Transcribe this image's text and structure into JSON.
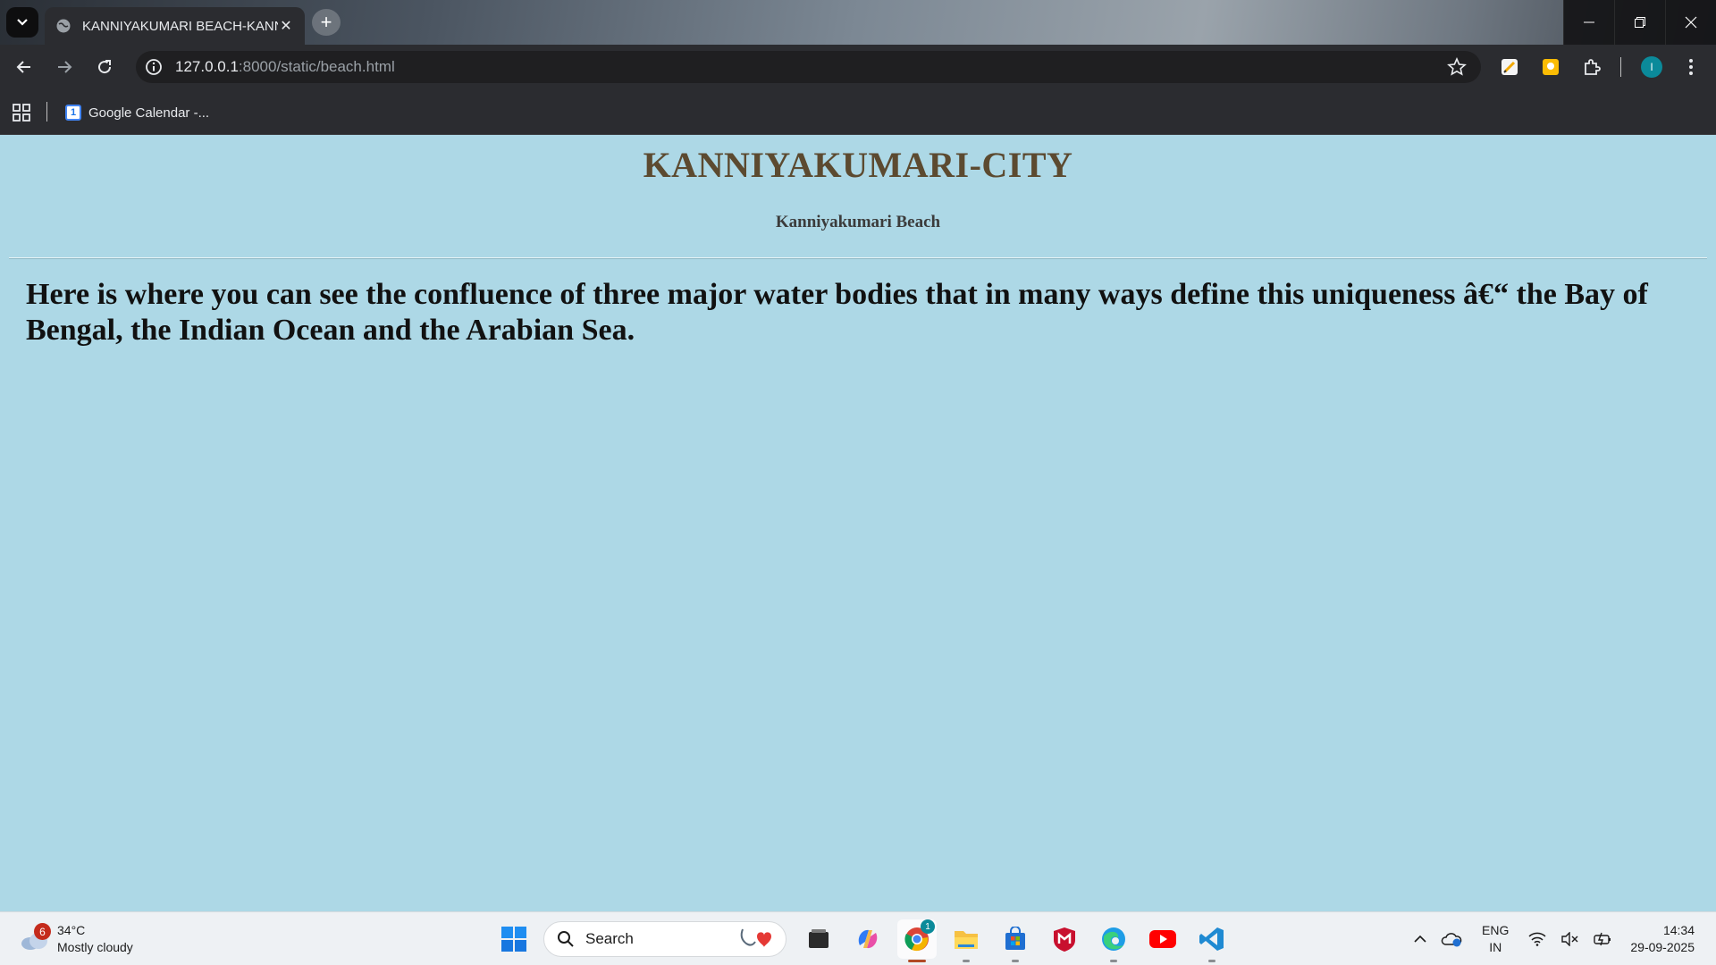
{
  "browser": {
    "tab_title": "KANNIYAKUMARI BEACH-KANNIYAKUMARI",
    "url_host": "127.0.0.1",
    "url_rest": ":8000/static/beach.html",
    "bookmark_label": "Google Calendar -...",
    "bookmark_icon_text": "1",
    "profile_initial": "I"
  },
  "page": {
    "heading": "KANNIYAKUMARI-CITY",
    "subheading": "Kanniyakumari Beach",
    "paragraph": "Here is where you can see the confluence of three major water bodies that in many ways define this uniqueness â€“ the Bay of Bengal, the Indian Ocean and the Arabian Sea.",
    "background_color": "#add8e6",
    "heading_color": "#5c4a30"
  },
  "taskbar": {
    "weather_badge": "6",
    "temperature": "34°C",
    "condition": "Mostly cloudy",
    "search_label": "Search",
    "chrome_badge": "1",
    "language_line1": "ENG",
    "language_line2": "IN",
    "time": "14:34",
    "date": "29-09-2025"
  }
}
